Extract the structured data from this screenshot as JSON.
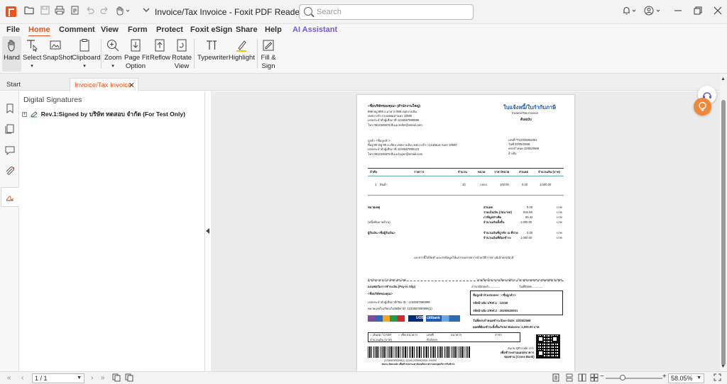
{
  "app": {
    "document_title": "Invoice/Tax Invoice - Foxit PDF Reader",
    "search_placeholder": "Search"
  },
  "menu": [
    {
      "label": "File"
    },
    {
      "label": "Home"
    },
    {
      "label": "Comment"
    },
    {
      "label": "View"
    },
    {
      "label": "Form"
    },
    {
      "label": "Protect"
    },
    {
      "label": "Foxit eSign"
    },
    {
      "label": "Share"
    },
    {
      "label": "Help"
    },
    {
      "label": "AI Assistant"
    }
  ],
  "active_menu": "Home",
  "ribbon": {
    "hand": "Hand",
    "select": "Select",
    "snapshot": "SnapShot",
    "clipboard": "Clipboard",
    "zoom": "Zoom",
    "page_fit_1": "Page Fit",
    "page_fit_2": "Option",
    "rotate_1": "Rotate",
    "rotate_2": "View",
    "reflow": "Reflow",
    "typewriter": "Typewriter",
    "highlight": "Highlight",
    "fill_1": "Fill &",
    "fill_2": "Sign"
  },
  "tabs": [
    {
      "label": "Start"
    },
    {
      "label": "Invoice/Tax Invoice"
    }
  ],
  "panel": {
    "title": "Digital Signatures",
    "signature": "Rev.1:Signed by บริษัท ทดสอบ จำกัด (For Test Only)",
    "toggle": "+"
  },
  "invoice": {
    "seller_name": "<ชื่อบริษัทของคุณ> (สำนักงานใหญ่)",
    "seller_addr1": "999 หมู่ 999 อ.อาคาร 999 เขตบางเลิม",
    "seller_addr2": "เขตบางรัก กรุงเทพมหานคร 10500",
    "seller_tax": "เลขประจำตัวผู้เสียภาษี 1234567890999",
    "seller_contact": "โทร 0912345678  อีเมล seller@email.com",
    "doc_title": "ใบแจ้งหนี้/ใบกำกับภาษี",
    "doc_title_en": "Invoice/Tax Invoice",
    "doc_copy": "ต้นฉบับ",
    "buyer_label": "ลูกค้า <ชื่อลูกค้า>",
    "buyer_addr1": "ที่อยู่ 99 หมู่ 99 อ.เลียบ เขตบางเลิม เขตบางรัก กรุงเทพมหานคร 10500",
    "buyer_tax": "เลขประจำตัวผู้เสียภาษี 1234567890123",
    "buyer_contact": "โทร 0812345678  อีเมล buyer@email.com",
    "doc_no": "เลขที่  TIV2025052001",
    "doc_date": "วันที่   20/05/2568",
    "due_date": "ครบกำหนด 22/05/2568",
    "ref": "อ้างอิง",
    "col_no": "ลำดับ",
    "col_item": "รายการ",
    "col_qty": "จำนวน",
    "col_unit": "หน่วย",
    "col_price": "ราคา/หน่วย",
    "col_disc": "ส่วนลด",
    "col_amount": "จำนวนเงิน (บาท)",
    "row_no": "1",
    "row_item": "สินค้า",
    "row_qty": "10",
    "row_unit": "กล่อง",
    "row_price": "100.00",
    "row_disc": "0.00",
    "row_amount": "1,000.00",
    "note_label": "หมายเหตุ",
    "sum_labels": [
      "ส่วนลด",
      "รวมเป็นเงิน (ก่อน Vat)",
      "ภาษีมูลค่าเพิ่ม",
      "จำนวนเงินทั้งสิ้น"
    ],
    "sum_values": [
      "0.00",
      "934.58",
      "65.42",
      "1,000.00"
    ],
    "currency": "บาท",
    "amount_words": "(หนึ่งพันบาทถ้วน)",
    "approver": "ผู้รับเงิน <ชื่อผู้รับเงิน>",
    "withheld_label": "จำนวนเงินที่ถูกหัก ณ ที่จ่าย",
    "withheld_value": "0.00",
    "net_label": "จำนวนเงินที่ต้องชำระ",
    "net_value": "1,000.00",
    "footer_note": "เอกสารนี้ได้จัดทำและส่งข้อมูลให้แก่กรมสรรพากรด้วยวิธีการทางอิเล็กทรอนิกส์",
    "bank_note_left": "สำหรับธนาคาร (For Bank Use Only)",
    "bank_note_right": "โปรดเรียกเก็บค่าธรรมเนียมจากผู้ชำระ (The right customer is responsible for fees)",
    "payin_title": "แบบฟอร์มการชำระเงิน (Pay-in Slip)",
    "branch": "สาขา/Branch.............",
    "date_field": "วันที่/Date.............",
    "company_name2": "<ชื่อบริษัทของคุณ>",
    "tax_id2": "เลขประจำตัวผู้เสียภาษี/Tax ID : 1234567890999",
    "biller_id": "หมายเลขใบเรียกเก็บ/Biller ID: 1234567890999(1)",
    "cust_name": "ชื่อลูกค้า/Customer : <ชื่อลูกค้า>",
    "ref1": "รหัสอ้างอิง 1/Ref.1 : 12345",
    "ref2": "รหัสอ้างอิง 2/Ref.2 : 20250520001",
    "due_line": "วันที่ครบกำหนดชำระ/Due Date: 22/05/2568",
    "total_line": "ยอดที่ต้องชำระทั้งสิ้น/Total Balance: 1,000.00 บาท",
    "bank_logo": "UOB",
    "bank_logo2": "citibank",
    "pay_cash": "เงินสด / CASH",
    "pay_cheque": "เช็ค ธนาคาร",
    "cheque_no": "เลขที่",
    "bank_name": "ธนาคาร",
    "branch2": "สาขา",
    "amount_baht": "จำนวนเงิน (บาท)",
    "amount_words2": "ตัวอักษร :",
    "qr_note1": "สแกน QR code >>>",
    "qr_note2": "เพื่อชำระผ่านแอปธนาคาร",
    "qr_note3": "ของท่าน (Cross Bank)",
    "barcode_text": "|1234567890999(1) 12345 20250520001 100000",
    "barcode_note": "สแกน Barcode เพื่อชำระผ่านเคาน์เตอร์ธนาคารและจุดบริการรับชำระ"
  },
  "status": {
    "page": "1 / 1",
    "zoom": "58.05%",
    "zoom_fraction": 0.3
  },
  "colors": {
    "accent": "#e8541c",
    "ai": "#6a5cd6",
    "invoice_title": "#1f5ba8",
    "tip_fab": "#f2873a"
  }
}
